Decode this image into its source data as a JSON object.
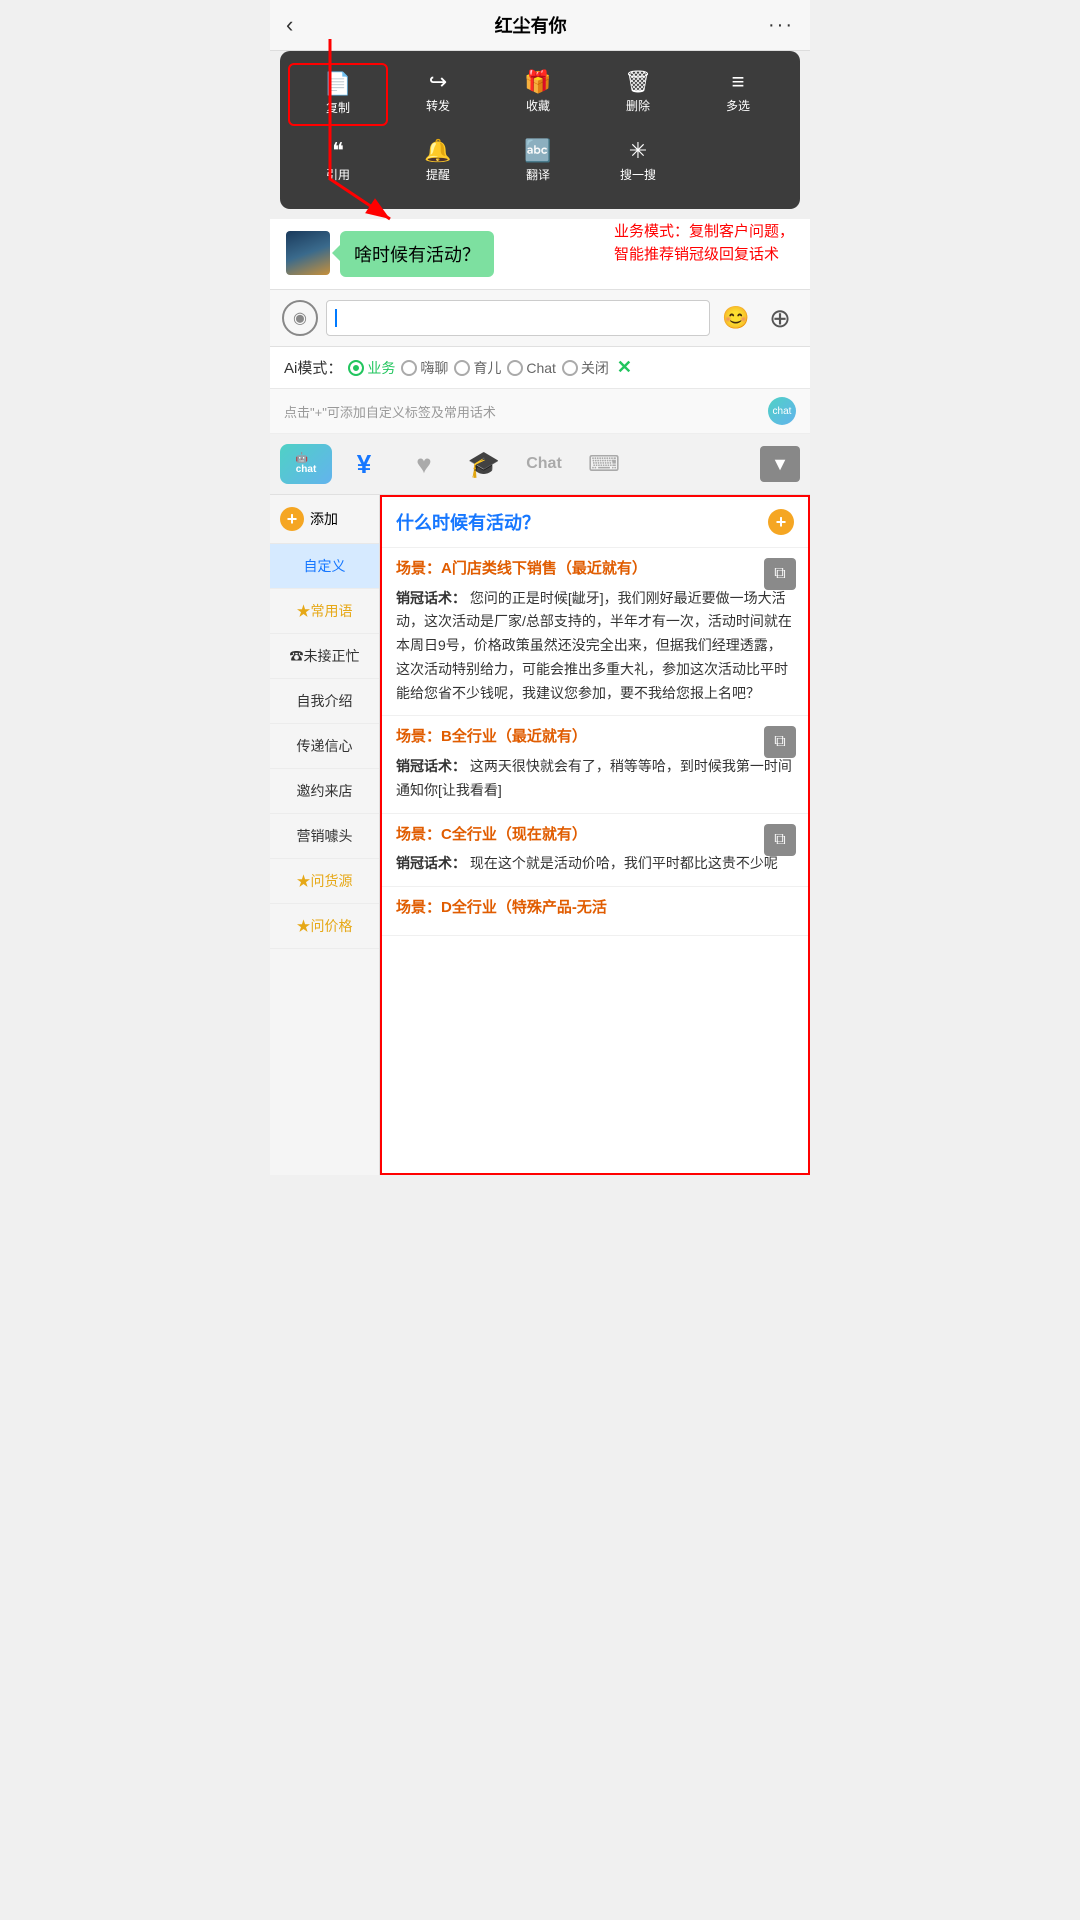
{
  "header": {
    "back_icon": "‹",
    "title": "红尘有你",
    "more_icon": "···"
  },
  "context_menu": {
    "row1": [
      {
        "id": "copy",
        "icon": "📄",
        "label": "复制",
        "highlighted": true
      },
      {
        "id": "forward",
        "icon": "↪",
        "label": "转发"
      },
      {
        "id": "favorite",
        "icon": "🎁",
        "label": "收藏"
      },
      {
        "id": "delete",
        "icon": "🗑",
        "label": "删除"
      },
      {
        "id": "multi",
        "icon": "☰",
        "label": "多选"
      }
    ],
    "row2": [
      {
        "id": "quote",
        "icon": "❝",
        "label": "引用"
      },
      {
        "id": "remind",
        "icon": "🔔",
        "label": "提醒"
      },
      {
        "id": "translate",
        "icon": "🔤",
        "label": "翻译"
      },
      {
        "id": "search",
        "icon": "✳",
        "label": "搜一搜"
      }
    ]
  },
  "chat": {
    "bubble_text": "啥时候有活动？",
    "annotation": "业务模式：复制客户问题，\n智能推荐销冠级回复话术"
  },
  "input": {
    "placeholder": "",
    "voice_icon": "📻",
    "emoji_label": "😊",
    "plus_label": "+"
  },
  "ai_modes": {
    "label": "Ai模式：",
    "options": [
      {
        "id": "business",
        "label": "业务",
        "active": true
      },
      {
        "id": "chat",
        "label": "嗨聊",
        "active": false
      },
      {
        "id": "parenting",
        "label": "育儿",
        "active": false
      },
      {
        "id": "chat2",
        "label": "Chat",
        "active": false
      },
      {
        "id": "off",
        "label": "关闭",
        "active": false
      }
    ],
    "close_label": "✕"
  },
  "tag_hint": {
    "text": "点击\"+\"可添加自定义标签及常用话术",
    "chat_icon_label": "chat"
  },
  "toolbar": {
    "items": [
      {
        "id": "robot",
        "icon": "🤖",
        "label": "chat",
        "active": true,
        "is_chat": true
      },
      {
        "id": "money",
        "icon": "¥",
        "label": "money"
      },
      {
        "id": "heart",
        "icon": "♥",
        "label": "heart"
      },
      {
        "id": "graduation",
        "icon": "🎓",
        "label": "graduation"
      },
      {
        "id": "chat_text",
        "icon": "Chat",
        "label": "Chat"
      },
      {
        "id": "keyboard",
        "icon": "⌨",
        "label": "keyboard"
      }
    ],
    "dropdown_icon": "▼"
  },
  "sidebar": {
    "add_label": "添加",
    "items": [
      {
        "id": "custom",
        "label": "自定义",
        "active": true
      },
      {
        "id": "common",
        "label": "★常用语"
      },
      {
        "id": "busy",
        "label": "☎未接正忙"
      },
      {
        "id": "intro",
        "label": "自我介绍"
      },
      {
        "id": "confidence",
        "label": "传递信心"
      },
      {
        "id": "invite",
        "label": "邀约来店"
      },
      {
        "id": "marketing",
        "label": "营销噱头"
      },
      {
        "id": "source",
        "label": "★问货源"
      },
      {
        "id": "price",
        "label": "★问价格"
      }
    ]
  },
  "panel": {
    "title": "什么时候有活动？",
    "scenarios": [
      {
        "id": "A",
        "title": "场景：A门店类线下销售（最近就有）",
        "content_label": "销冠话术：",
        "content_text": "您问的正是时候[龇牙]，我们刚好最近要做一场大活动，这次活动是厂家/总部支持的，半年才有一次，活动时间就在本周日9号，价格政策虽然还没完全出来，但据我们经理透露，这次活动特别给力，可能会推出多重大礼，参加这次活动比平时能给您省不少钱呢，我建议您参加，要不我给您报上名吧？"
      },
      {
        "id": "B",
        "title": "场景：B全行业（最近就有）",
        "content_label": "销冠话术：",
        "content_text": "这两天很快就会有了，稍等等哈，到时候我第一时间通知你[让我看看]"
      },
      {
        "id": "C",
        "title": "场景：C全行业（现在就有）",
        "content_label": "销冠话术：",
        "content_text": "现在这个就是活动价哈，我们平时都比这贵不少呢"
      },
      {
        "id": "D",
        "title": "场景：D全行业（特殊产品-无活",
        "content_label": "",
        "content_text": ""
      }
    ]
  }
}
